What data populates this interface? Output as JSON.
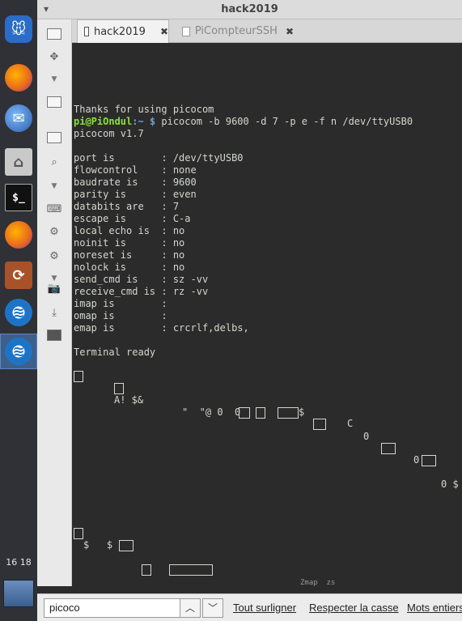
{
  "window": {
    "title": "hack2019",
    "menu_glyph": "▾"
  },
  "dock": {
    "items": [
      {
        "name": "xfce-icon",
        "glyph": "🐭",
        "color": "#2a6cc7"
      },
      {
        "name": "firefox-icon",
        "glyph": "",
        "color": "#e8671f"
      },
      {
        "name": "thunderbird-icon",
        "glyph": "",
        "color": "#3a78c9"
      },
      {
        "name": "folder-home-icon",
        "glyph": "⌂",
        "color": "#b8b8b8"
      },
      {
        "name": "terminal-icon",
        "glyph": "$_",
        "color": "#111111"
      },
      {
        "name": "firefox-icon-2",
        "glyph": "",
        "color": "#e8671f"
      },
      {
        "name": "sync-icon",
        "glyph": "⟳",
        "color": "#a8522a"
      },
      {
        "name": "kodi-like-icon",
        "glyph": "≋",
        "color": "#1d74c7"
      },
      {
        "name": "kodi-like-icon-2",
        "glyph": "≋",
        "color": "#1d74c7"
      }
    ],
    "clock": "16 18"
  },
  "tabs": [
    {
      "label": "hack2019",
      "close": "✖",
      "active": true
    },
    {
      "label": "PiCompteurSSH",
      "close": "✖",
      "active": false
    }
  ],
  "terminal": {
    "lines": [
      "Thanks for using picocom",
      "",
      "picocom v1.7",
      "",
      "port is        : /dev/ttyUSB0",
      "flowcontrol    : none",
      "baudrate is    : 9600",
      "parity is      : even",
      "databits are   : 7",
      "escape is      : C-a",
      "local echo is  : no",
      "noinit is      : no",
      "noreset is     : no",
      "nolock is      : no",
      "send_cmd is    : sz -vv",
      "receive_cmd is : rz -vv",
      "imap is        :",
      "omap is        :",
      "emap is        : crcrlf,delbs,",
      "",
      "Terminal ready"
    ],
    "prompt": {
      "user": "pi@PiOndul",
      "path": ":~ $",
      "command": " picocom -b 9600 -d 7 -p e -f n /dev/ttyUSB0"
    },
    "garbage": {
      "g1": "A! $&",
      "g2": "\"  \"@ 0  0",
      "g3": "$",
      "g4": "C",
      "g5": "0",
      "g6": "0",
      "g7": "0 $",
      "g8": "$   $",
      "g9": "Zmap  zs"
    }
  },
  "findbar": {
    "close_glyph": "✕",
    "query": "picoco",
    "up_glyph": "︿",
    "down_glyph": "﹀",
    "highlight_all": "Tout surligner",
    "match_case": "Respecter la casse",
    "whole_words": "Mots entiers"
  }
}
